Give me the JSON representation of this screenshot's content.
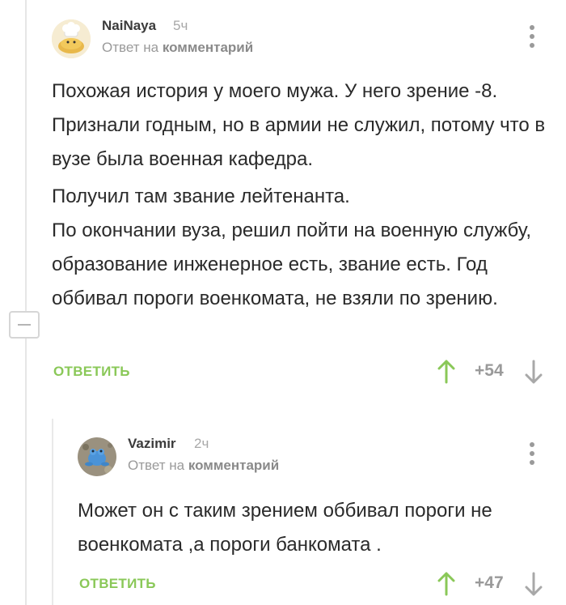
{
  "comment1": {
    "username": "NaiNaya",
    "time": "5ч",
    "reply_to_prefix": "Ответ на",
    "reply_to_target": "комментарий",
    "paragraphs": [
      "Похожая история у моего мужа. У него зрение -8. Признали годным, но в армии не служил, потому что в вузе была военная кафедра.",
      "Получил там звание лейтенанта.\nПо окончании вуза, решил пойти на военную службу, образование инженерное есть, звание есть. Год оббивал пороги военкомата, не взяли по зрению."
    ],
    "reply_label": "ОТВЕТИТЬ",
    "rating": "+54"
  },
  "comment2": {
    "username": "Vazimir",
    "time": "2ч",
    "reply_to_prefix": "Ответ на",
    "reply_to_target": "комментарий",
    "paragraphs": [
      "Может он с таким зрением оббивал пороги не военкомата ,а пороги банкомата ."
    ],
    "reply_label": "ОТВЕТИТЬ",
    "rating": "+47"
  },
  "colors": {
    "accent_green": "#8ac858",
    "muted_gray": "#9a9a9a"
  },
  "icons": [
    "more-icon",
    "vote-up-icon",
    "vote-down-icon",
    "collapse-icon",
    "avatar"
  ]
}
